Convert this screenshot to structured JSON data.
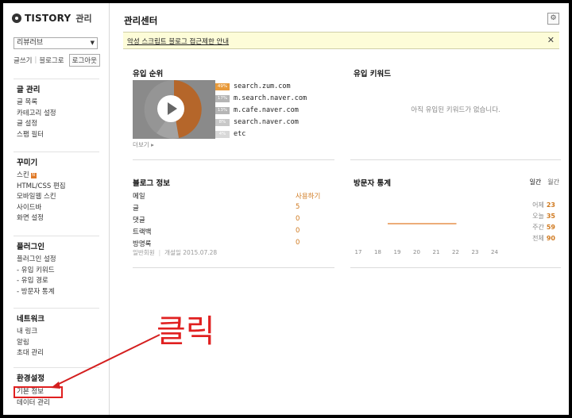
{
  "sidebar": {
    "brand": "TISTORY",
    "admin_label": "관리",
    "blog_select": "리뷰러브",
    "links": {
      "write": "글쓰기",
      "go_blog": "블로그로",
      "logout": "로그아웃"
    },
    "groups": [
      {
        "title": "글 관리",
        "items": [
          "글 목록",
          "카테고리 설정",
          "글 설정",
          "스팸 필터"
        ]
      },
      {
        "title": "꾸미기",
        "items": [
          "스킨",
          "HTML/CSS 편집",
          "모바일웹 스킨",
          "사이드바",
          "화면 설정"
        ],
        "skin_badge": "N"
      },
      {
        "title": "플러그인",
        "items": [
          "플러그인 설정",
          "- 유입 키워드",
          "- 유입 경로",
          "- 방문자 통계"
        ]
      },
      {
        "title": "네트워크",
        "items": [
          "내 링크",
          "알림",
          "초대 관리"
        ]
      },
      {
        "title": "환경설정",
        "items": [
          "기본 정보",
          "데이터 관리"
        ]
      }
    ]
  },
  "main": {
    "title": "관리센터",
    "notice": "악성 스크립트 블로그 접근제한 안내",
    "referrers": {
      "title": "유입 순위",
      "more": "더보기 ▸",
      "items": [
        {
          "percent": "49%",
          "host": "search.zum.com",
          "color": "#e89a3a"
        },
        {
          "percent": "17%",
          "host": "m.search.naver.com",
          "color": "#b5b5b5"
        },
        {
          "percent": "13%",
          "host": "m.cafe.naver.com",
          "color": "#b5b5b5"
        },
        {
          "percent": "8%",
          "host": "search.naver.com",
          "color": "#c8c8c8"
        },
        {
          "percent": "4%",
          "host": "etc",
          "color": "#d8d8d8"
        }
      ]
    },
    "keywords": {
      "title": "유입 키워드",
      "empty": "아직 유입된 키워드가 없습니다."
    },
    "blog_info": {
      "title": "블로그 정보",
      "rows": [
        {
          "label": "메일",
          "value": "사용하기"
        },
        {
          "label": "글",
          "value": "5"
        },
        {
          "label": "댓글",
          "value": "0"
        },
        {
          "label": "트랙백",
          "value": "0"
        },
        {
          "label": "방명록",
          "value": "0"
        }
      ],
      "meta_left": "일반회원",
      "meta_right": "개설일  2015.07.28"
    },
    "visitors": {
      "title": "방문자 통계",
      "toggle_daily": "일간",
      "toggle_monthly": "월간",
      "summary": [
        {
          "label": "어제",
          "value": "23"
        },
        {
          "label": "오늘",
          "value": "35"
        },
        {
          "label": "주간",
          "value": "59"
        },
        {
          "label": "전체",
          "value": "90"
        }
      ]
    }
  },
  "chart_data": {
    "type": "line",
    "x": [
      "17",
      "18",
      "19",
      "20",
      "21",
      "22",
      "23",
      "24"
    ],
    "series": [
      {
        "values": [
          null,
          null,
          0,
          0,
          0,
          0,
          null,
          null
        ]
      }
    ],
    "colors": {
      "line": "#e07a28"
    }
  },
  "annotation": {
    "text": "클릭",
    "color": "#e02020"
  }
}
